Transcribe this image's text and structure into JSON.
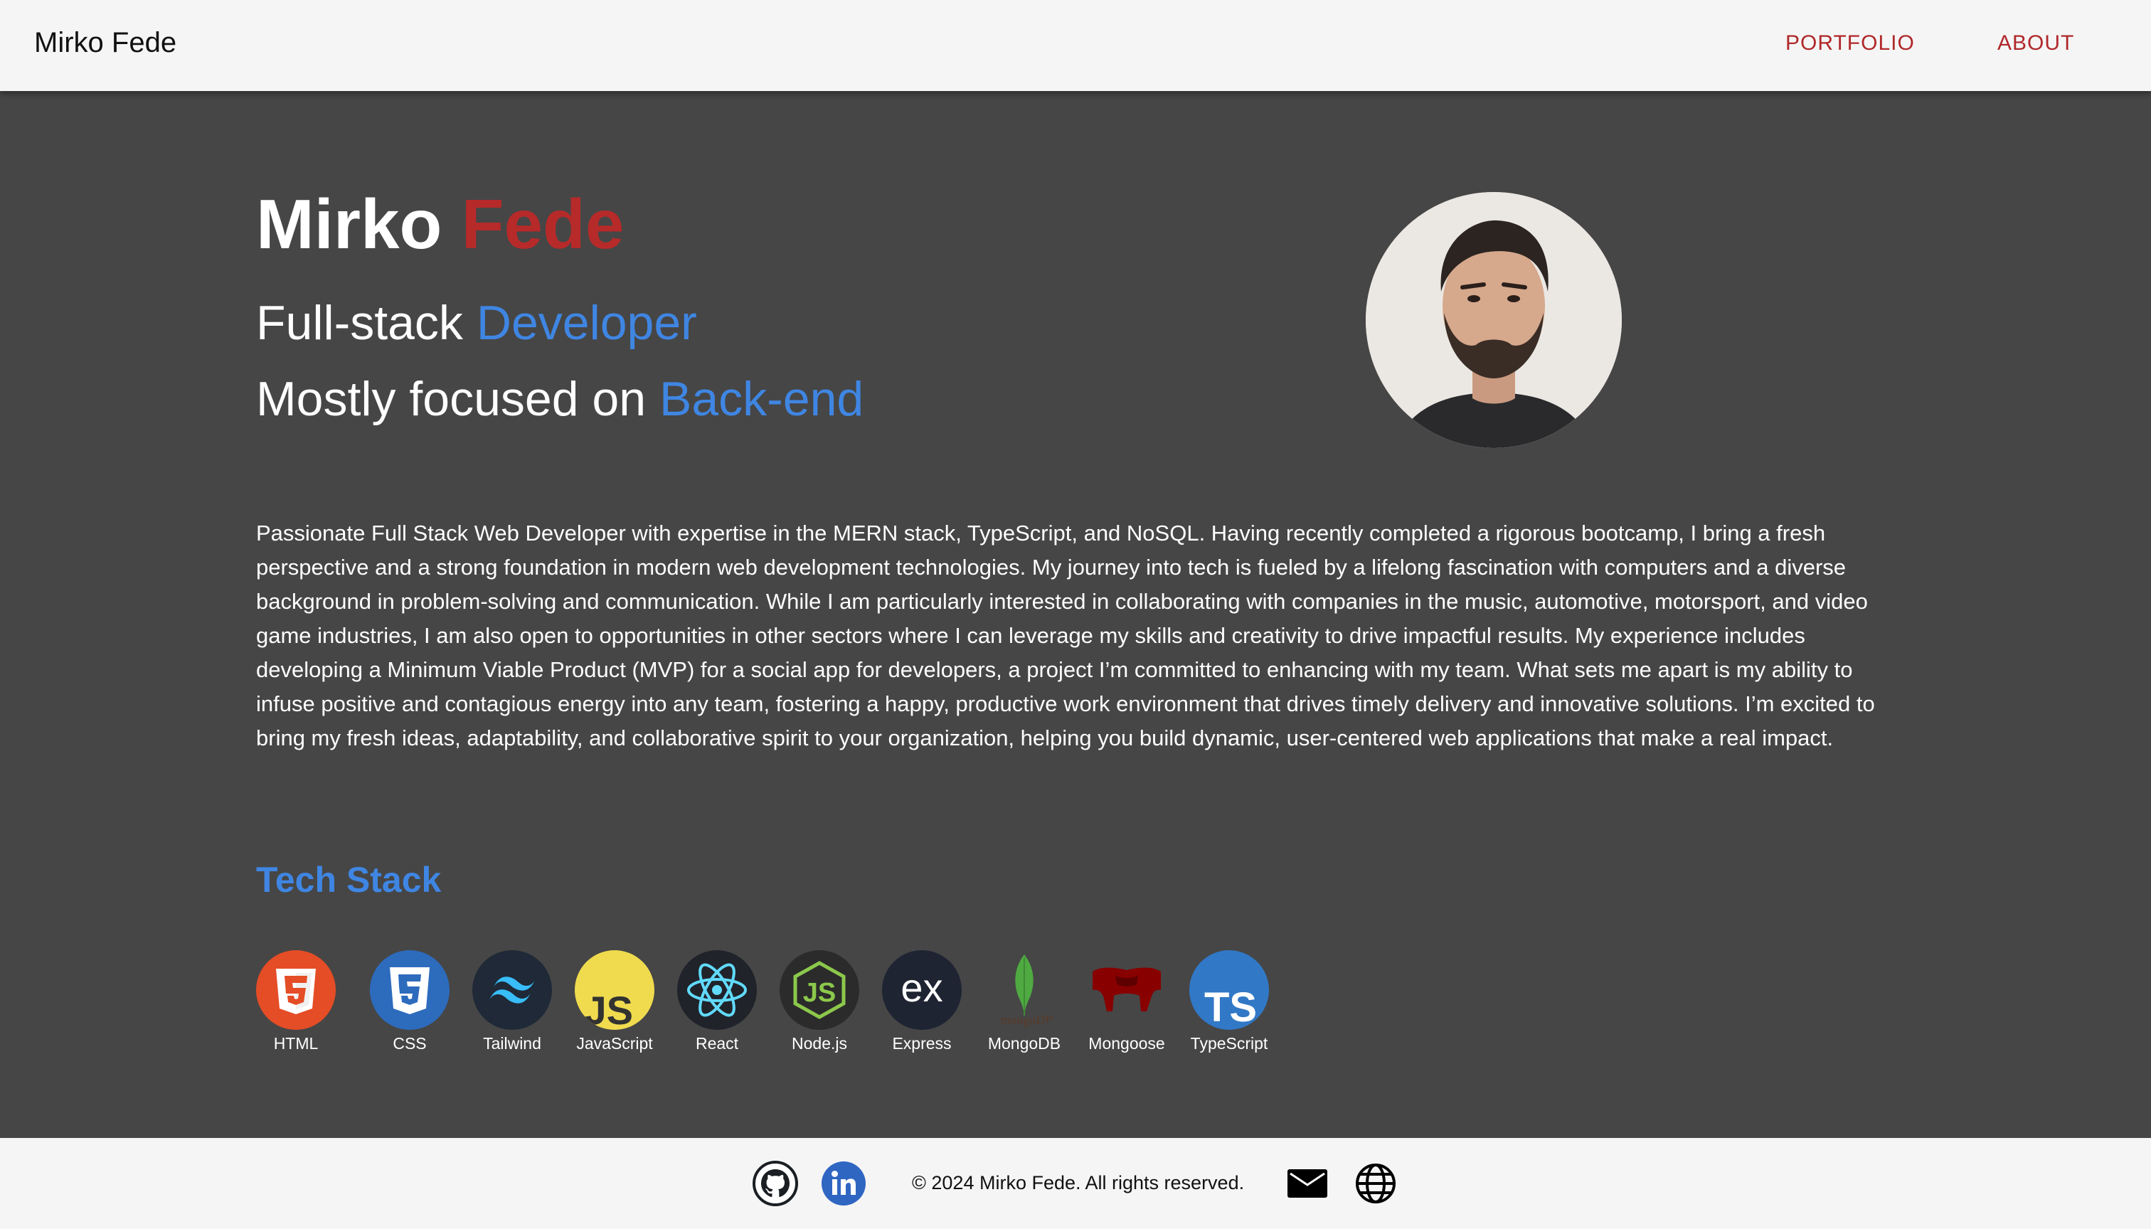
{
  "header": {
    "brand": "Mirko Fede",
    "nav": {
      "portfolio": "PORTFOLIO",
      "about": "ABOUT"
    }
  },
  "hero": {
    "first_name": "Mirko",
    "last_name": "Fede",
    "role_prefix": "Full-stack",
    "role_accent": "Developer",
    "focus_prefix": "Mostly focused on",
    "focus_accent": "Back-end"
  },
  "bio": "Passionate Full Stack Web Developer with expertise in the MERN stack, TypeScript, and NoSQL. Having recently completed a rigorous bootcamp, I bring a fresh perspective and a strong foundation in modern web development technologies. My journey into tech is fueled by a lifelong fascination with computers and a diverse background in problem-solving and communication. While I am particularly interested in collaborating with companies in the music, automotive, motorsport, and video game industries, I am also open to opportunities in other sectors where I can leverage my skills and creativity to drive impactful results. My experience includes developing a Minimum Viable Product (MVP) for a social app for developers, a project I’m committed to enhancing with my team. What sets me apart is my ability to infuse positive and contagious energy into any team, fostering a happy, productive work environment that drives timely delivery and innovative solutions. I’m excited to bring my fresh ideas, adaptability, and collaborative spirit to your organization, helping you build dynamic, user-centered web applications that make a real impact.",
  "tech_stack": {
    "title": "Tech Stack",
    "items": [
      {
        "label": "HTML",
        "icon": "html5-icon",
        "color": "#e44d26"
      },
      {
        "label": "CSS",
        "icon": "css3-icon",
        "color": "#2d6bbd"
      },
      {
        "label": "Tailwind",
        "icon": "tailwind-icon",
        "color": "#1f2937"
      },
      {
        "label": "JavaScript",
        "icon": "javascript-icon",
        "color": "#f0db4f"
      },
      {
        "label": "React",
        "icon": "react-icon",
        "color": "#20232a"
      },
      {
        "label": "Node.js",
        "icon": "nodejs-icon",
        "color": "#2b2b2b"
      },
      {
        "label": "Express",
        "icon": "express-icon",
        "color": "#1f2433"
      },
      {
        "label": "MongoDB",
        "icon": "mongodb-icon",
        "color": "#4faa41"
      },
      {
        "label": "Mongoose",
        "icon": "mongoose-icon",
        "color": "#880000"
      },
      {
        "label": "TypeScript",
        "icon": "typescript-icon",
        "color": "#3178c6"
      }
    ]
  },
  "footer": {
    "copyright": "© 2024 Mirko Fede. All rights reserved.",
    "icons": [
      "github-icon",
      "linkedin-icon",
      "mail-icon",
      "globe-icon"
    ]
  },
  "colors": {
    "accent_red": "#b72a2a",
    "accent_blue": "#3f86e3",
    "background": "#464646",
    "bars": "#f5f5f5"
  }
}
